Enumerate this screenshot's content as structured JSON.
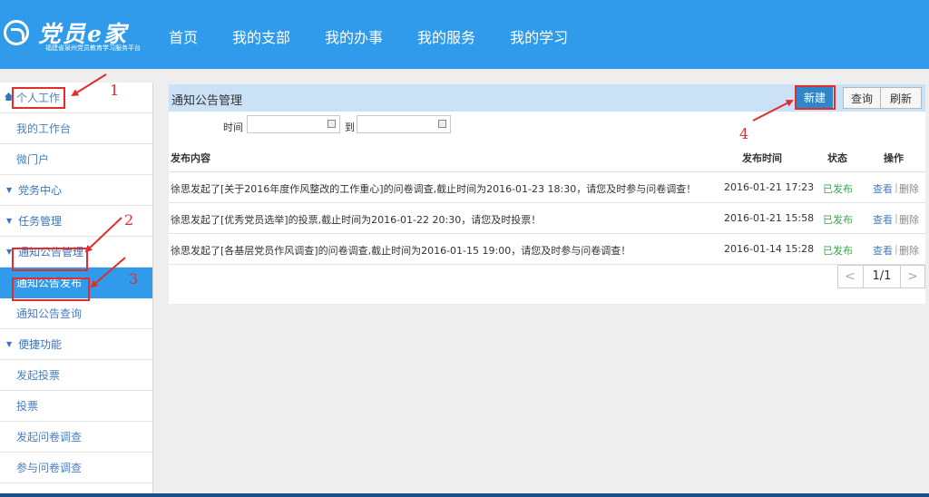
{
  "app": {
    "logo_text": "党员e家",
    "logo_subtitle": "福建省泉州党员教育学习服务平台"
  },
  "nav": {
    "items": [
      "首页",
      "我的支部",
      "我的办事",
      "我的服务",
      "我的学习"
    ]
  },
  "sidebar": {
    "items": [
      {
        "label": "个人工作",
        "type": "home"
      },
      {
        "label": "我的工作台",
        "type": "link"
      },
      {
        "label": "微门户",
        "type": "link"
      },
      {
        "label": "党务中心",
        "type": "group"
      },
      {
        "label": "任务管理",
        "type": "group"
      },
      {
        "label": "通知公告管理",
        "type": "group"
      },
      {
        "label": "通知公告发布",
        "type": "active"
      },
      {
        "label": "通知公告查询",
        "type": "link"
      },
      {
        "label": "便捷功能",
        "type": "group"
      },
      {
        "label": "发起投票",
        "type": "link"
      },
      {
        "label": "投票",
        "type": "link"
      },
      {
        "label": "发起问卷调查",
        "type": "link"
      },
      {
        "label": "参与问卷调查",
        "type": "link"
      }
    ]
  },
  "panel": {
    "title": "通知公告管理",
    "buttons": {
      "new": "新建",
      "query": "查询",
      "refresh": "刷新"
    },
    "filter": {
      "time_label": "时间",
      "to_label": "到",
      "start_value": "",
      "end_value": ""
    },
    "table": {
      "headers": [
        "发布内容",
        "发布时间",
        "状态",
        "操作"
      ],
      "rows": [
        {
          "content": "徐思发起了[关于2016年度作风整改的工作重心]的问卷调查,截止时间为2016-01-23 18:30，请您及时参与问卷调查！",
          "time": "2016-01-21 17:23",
          "status": "已发布",
          "view": "查看",
          "sep": "|",
          "delete": "删除"
        },
        {
          "content": "徐思发起了[优秀党员选举]的投票,截止时间为2016-01-22 20:30，请您及时投票！",
          "time": "2016-01-21 15:58",
          "status": "已发布",
          "view": "查看",
          "sep": "|",
          "delete": "删除"
        },
        {
          "content": "徐思发起了[各基层党员作风调查]的问卷调查,截止时间为2016-01-15 19:00，请您及时参与问卷调查！",
          "time": "2016-01-14 15:28",
          "status": "已发布",
          "view": "查看",
          "sep": "|",
          "delete": "删除"
        }
      ]
    },
    "pager": {
      "prev": "<",
      "page": "1/1",
      "next": ">"
    }
  },
  "annotations": {
    "labels": [
      "1",
      "2",
      "3",
      "4"
    ],
    "color": "#e32c2c"
  },
  "colors": {
    "header": "#2f9bea",
    "active": "#2f9bea",
    "status_published": "#3aa64a"
  }
}
